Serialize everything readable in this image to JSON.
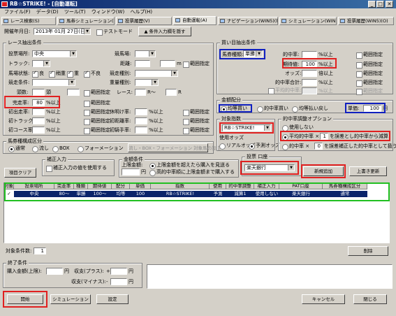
{
  "window": {
    "title": "RB☆STRIKE! - [自動運転]",
    "btn_min": "_",
    "btn_max": "□",
    "btn_close": "✕"
  },
  "menu": [
    "ファイル(F)",
    "データ(D)",
    "ツール(T)",
    "ウィンドウ(W)",
    "ヘルプ(H)"
  ],
  "tabs": [
    "レース検索(S)",
    "馬券シミュレーション(B)",
    "投票履歴(V)",
    "自動運転(A)",
    "ナビゲーション(WIN5)(N)",
    "シミュレーション(WIN5)(M)",
    "投票履歴(WIN5)(O)"
  ],
  "top": {
    "date_label": "開催年月日:",
    "date_value": "2013年 01月 27日(日)",
    "test_mode": "テストモード",
    "entry_button": "▲ 条件入力欄を隠す"
  },
  "race": {
    "legend": "レース抽出条件",
    "venue_label": "投票場所:",
    "venue_value": "中央",
    "track_label": "トラック:",
    "type_label": "競馬場:",
    "distance_label": "距離:",
    "distance_unit": "m",
    "range": "範囲指定",
    "condition_label": "馬場状態:",
    "cond_good": "良",
    "cond_slightly": "稍重",
    "cond_heavy": "重",
    "cond_bad": "不良",
    "race_type_label": "競走種別:",
    "age_label": "競走条件:",
    "weight_label": "重量種別:",
    "horse_count_label": "頭数:",
    "horse_count_unit": "頭",
    "race_label": "レース:",
    "race_mid": "R～",
    "race_unit": "R",
    "finish_label": "完走率:",
    "finish_value": "80",
    "pct_over": "%以上",
    "first_label": "初出走率:",
    "rest_label": "休明け率:",
    "first_track_label": "初トラック率:",
    "first_distance_label": "初距離率:",
    "first_course_label": "初コース率:",
    "first_jockey_label": "初騎手率:"
  },
  "betstyle": {
    "legend": "馬券種構成区分",
    "normal": "通常",
    "flow": "流し",
    "box": "BOX",
    "formation": "フォーメーション",
    "button": "流し・BOX・フォーメーション 対象馬の設定"
  },
  "item_clear": "項目クリア",
  "correction": {
    "legend": "補正入力",
    "checkbox": "補正入力の値を使用する"
  },
  "amount": {
    "legend": "金額条件",
    "limit_label": "上限金額:",
    "yen": "円",
    "opt1": "上限金額を超えたら購入を見送る",
    "opt2": "高的中率順に上限金額まで購入する"
  },
  "buy": {
    "legend": "買い目抽出条件",
    "type_label": "馬券種類:",
    "type_value": "単勝",
    "hit_rate": "的中率:",
    "expected": "期待値:",
    "expected_value": "100",
    "odds": "オッズ:",
    "multiple_over": "倍以上",
    "hit_total": "的中率合計:",
    "avg_hit": "平均的中率:",
    "range": "範囲指定",
    "pct_over": "%以上"
  },
  "allocation": {
    "legend": "金額配分",
    "equal": "均等買い",
    "by_hit": "的中率買い",
    "by_return": "均等払い戻し",
    "unit_label": "単価:",
    "unit_value": "100",
    "yen": "円"
  },
  "index": {
    "legend": "対象指数",
    "value": "RB☆STRIKE!",
    "odds_legend": "使用オッズ",
    "real": "リアルオッズ",
    "forecast": "予測オッズ"
  },
  "adjust": {
    "legend": "的中率調整オプション",
    "none": "使用しない",
    "avg_label": "平均的中率 ×",
    "avg_value": "1",
    "avg_suffix": "を誤差とし的中率から減算",
    "hit_label": "的中率 ×",
    "hit_value": "0",
    "hit_suffix": "を誤差補正した的中率として扱う"
  },
  "vote": {
    "legend": "投票 口座",
    "value": "楽天銀行",
    "add": "新規追加",
    "overwrite": "上書き更新"
  },
  "table": {
    "headers": [
      "対象",
      "投票場所",
      "完走率",
      "種類",
      "期待値",
      "配分",
      "単価",
      "指数",
      "使用",
      "的中率調整",
      "補正入力",
      "PAT口座",
      "馬券種構成区分"
    ],
    "row": [
      "✓",
      "中央",
      "80～",
      "単勝",
      "100～",
      "均等",
      "100",
      "RB☆STRIKE!",
      "予測",
      "減算1",
      "使用しない",
      "楽天銀行",
      "通常"
    ]
  },
  "condition_count_label": "対象条件数:",
  "condition_count": "1",
  "delete": "削除",
  "end": {
    "legend": "終了条件",
    "purchase_label": "購入金額(上限):",
    "yen": "円",
    "profit_label": "収支(プラス):",
    "plus": "+",
    "loss_label": "収支(マイナス):",
    "minus": "-"
  },
  "buttons": {
    "start": "開始",
    "simulation": "シミュレーション",
    "settings": "設定",
    "cancel": "キャンセル",
    "close": "閉じる"
  }
}
